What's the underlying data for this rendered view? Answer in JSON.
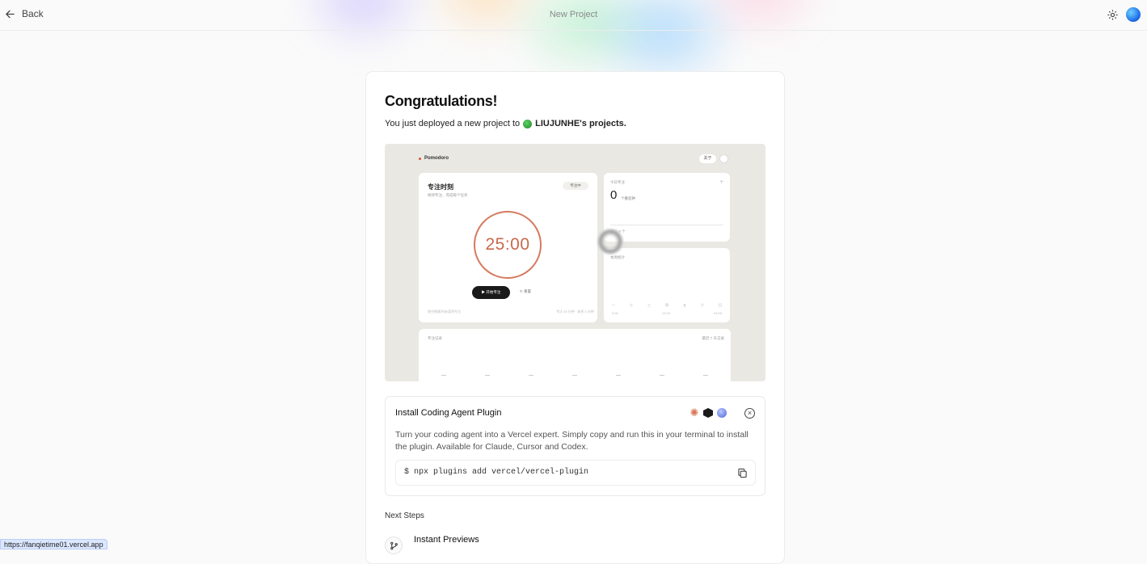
{
  "topbar": {
    "back_label": "Back",
    "title": "New Project"
  },
  "card": {
    "heading": "Congratulations!",
    "sub_prefix": "You just deployed a new project to",
    "team_name": "LIUJUNHE's projects."
  },
  "preview": {
    "brand": "Pomodoro",
    "pill": "关于",
    "main_title": "专注时刻",
    "main_sub": "保持专注，完成每个任务",
    "tag": "专注中",
    "timer": "25:00",
    "start": "▶ 开始专注",
    "reset": "↻ 重置",
    "foot_left": "按空格键开始/暂停专注",
    "foot_right": "专注 25 分钟 · 休息 5 分钟",
    "today_label": "今日专注",
    "today_right": "个",
    "today_value": "0",
    "today_unit": "个番茄钟",
    "today_foot": "目标 8 个",
    "week_label": "本周统计",
    "week_days": [
      "一",
      "二",
      "三",
      "四",
      "五",
      "六",
      "日"
    ],
    "week_axis": [
      "0:00",
      "12:00",
      "24:00"
    ],
    "history_label": "专注记录",
    "history_right": "最近 7 天记录"
  },
  "plugin": {
    "title": "Install Coding Agent Plugin",
    "description": "Turn your coding agent into a Vercel expert. Simply copy and run this in your terminal to install the plugin. Available for Claude, Cursor and Codex.",
    "command": "$ npx plugins add vercel/vercel-plugin",
    "icons": [
      "claude-icon",
      "cursor-icon",
      "codex-icon"
    ]
  },
  "next_steps": {
    "label": "Next Steps",
    "items": [
      {
        "title": "Instant Previews"
      }
    ]
  },
  "status_url": "https://fanqietime01.vercel.app"
}
